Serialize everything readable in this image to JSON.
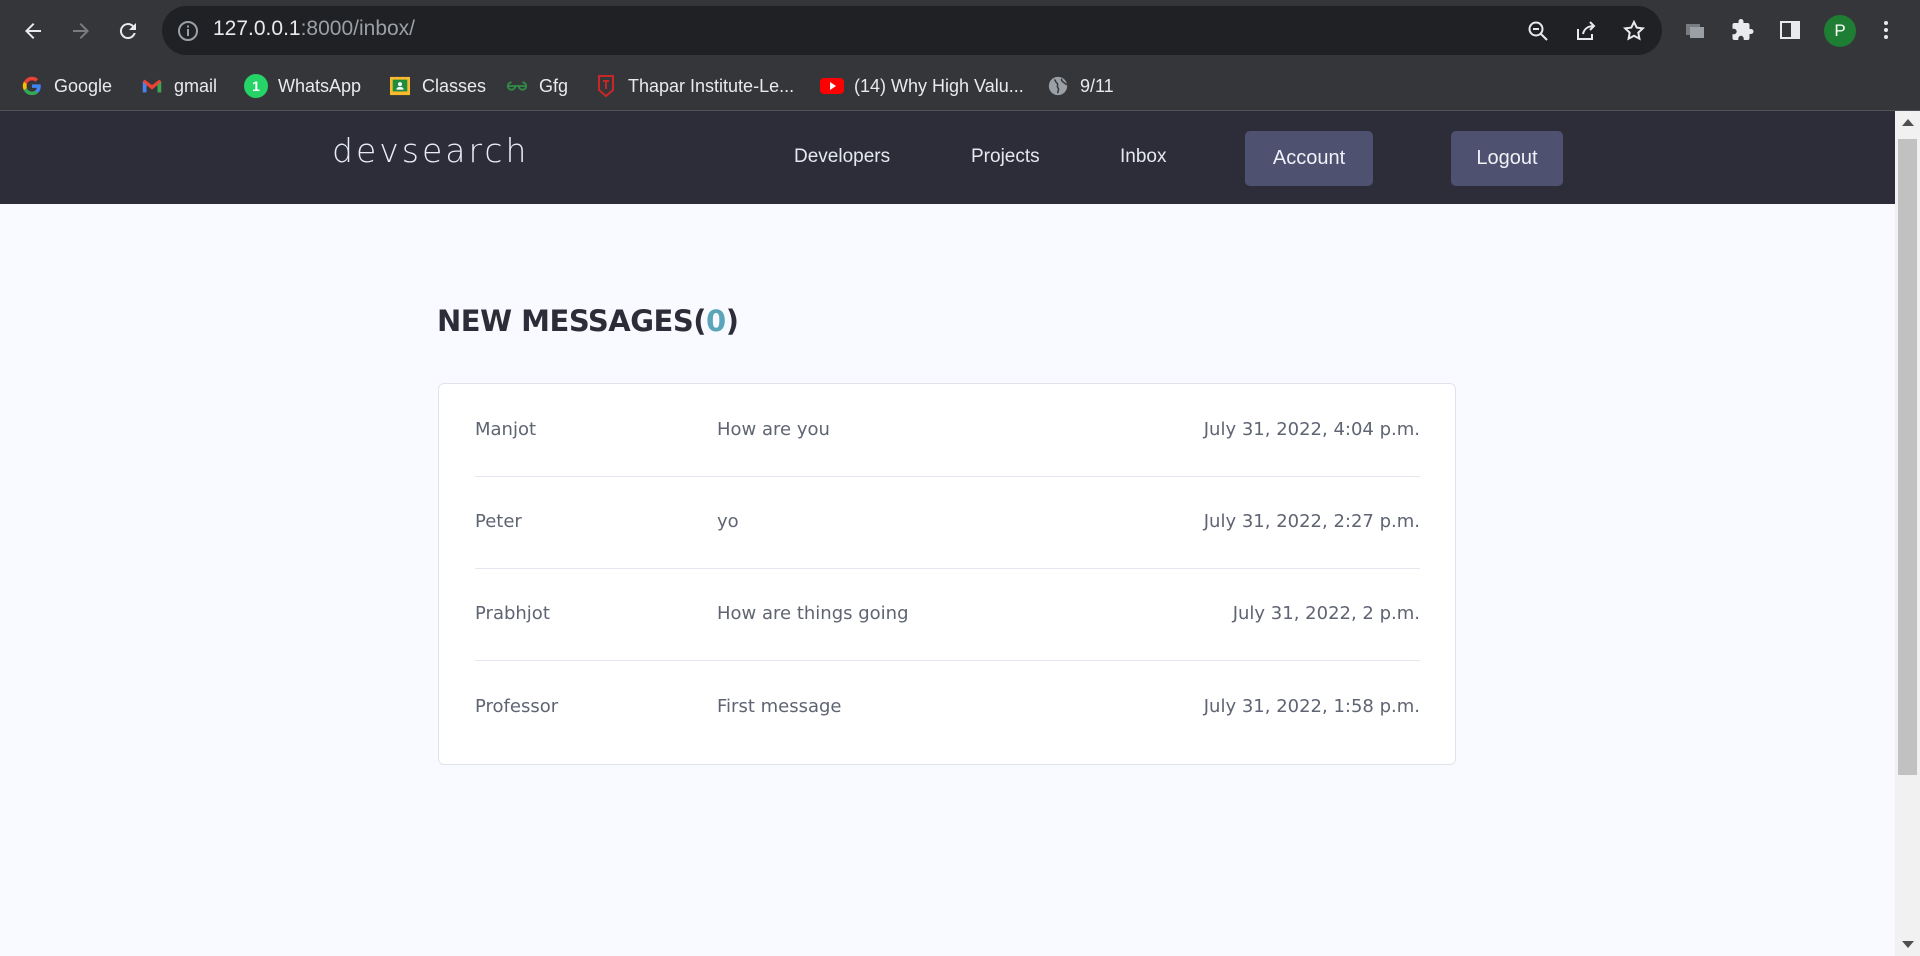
{
  "browser": {
    "url_host": "127.0.0.1",
    "url_rest": ":8000/inbox/",
    "profile_initial": "P",
    "bookmarks": [
      {
        "label": "Google",
        "icon": "google-icon"
      },
      {
        "label": "gmail",
        "icon": "gmail-icon"
      },
      {
        "label": "WhatsApp",
        "icon": "whatsapp-icon",
        "badge": "1"
      },
      {
        "label": "Classes",
        "icon": "classroom-icon"
      },
      {
        "label": "Gfg",
        "icon": "gfg-icon"
      },
      {
        "label": "Thapar Institute-Le...",
        "icon": "thapar-icon"
      },
      {
        "label": "(14) Why High Valu...",
        "icon": "youtube-icon"
      },
      {
        "label": "9/11",
        "icon": "globe-icon"
      }
    ]
  },
  "site": {
    "logo": "devsearch",
    "nav": {
      "developers": "Developers",
      "projects": "Projects",
      "inbox": "Inbox",
      "account": "Account",
      "logout": "Logout"
    }
  },
  "inbox": {
    "title": "NEW MESSAGES",
    "open_paren": "(",
    "count": "0",
    "close_paren": ")",
    "messages": [
      {
        "sender": "Manjot",
        "subject": "How are you",
        "date": "July 31, 2022, 4:04 p.m."
      },
      {
        "sender": "Peter",
        "subject": "yo",
        "date": "July 31, 2022, 2:27 p.m."
      },
      {
        "sender": "Prabhjot",
        "subject": "How are things going",
        "date": "July 31, 2022, 2 p.m."
      },
      {
        "sender": "Professor",
        "subject": "First message",
        "date": "July 31, 2022, 1:58 p.m."
      }
    ]
  },
  "colors": {
    "header_bg": "#2d2d39",
    "page_bg": "#f8faff",
    "accent": "#5aa5b9",
    "nav_button_bg": "#4e5270"
  }
}
